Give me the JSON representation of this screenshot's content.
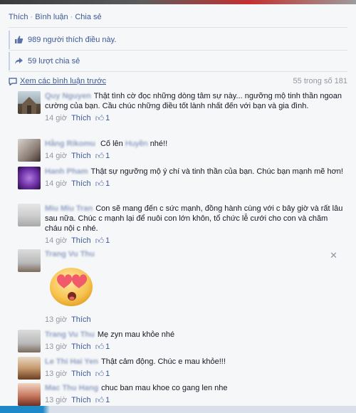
{
  "actions": {
    "like": "Thích",
    "comment": "Bình luận",
    "share": "Chia sẻ"
  },
  "likes": {
    "count": "989",
    "text": "người thích điều này."
  },
  "shares": {
    "text": "59 lượt chia sẻ"
  },
  "previous": {
    "label": "Xem các bình luận trước",
    "count": "55 trong số 181"
  },
  "comments": [
    {
      "author": "Quy Nguyen",
      "text": "Thật tình cờ đọc những dòng tâm sự này... ngưỡng mộ tinh thần ngoan cường của bạn. Cầu chúc những điều tốt lành nhất đến với bạn và gia đình.",
      "time": "14 giờ",
      "like": "Thích",
      "likes": "1"
    },
    {
      "author": "Hằng Rikomu",
      "text_pre": "Cố lên",
      "mention": "Huyền",
      "text_post": "nhé!!",
      "time": "14 giờ",
      "like": "Thích",
      "likes": "1"
    },
    {
      "author": "Hanh Pham",
      "text": "Thật sự ngưỡng mộ ý chí và tinh thần của bạn. Chúc bạn mạnh mẽ hơn!",
      "time": "14 giờ",
      "like": "Thích",
      "likes": "1"
    },
    {
      "author": "Miu Miu Tran",
      "text": "Con sẽ mang đến c sức mạnh, đồng hành cùng với c bây giờ và rất lâu sau nữa. Chúc c mạnh lại để nuôi con lớn khôn, tổ chức lễ cưới cho con và chăm cháu nội c nhé.",
      "time": "14 giờ",
      "like": "Thích",
      "likes": "1"
    },
    {
      "author": "Trang Vu Thu",
      "time": "13 giờ",
      "like": "Thích"
    },
    {
      "author": "Trang Vu Thu",
      "text": "Mẹ zyn mau khỏe nhé",
      "time": "13 giờ",
      "like": "Thích",
      "likes": "1"
    },
    {
      "author": "Le Thi Hai Yen",
      "text": "Thật cảm động. Chúc e mau khỏe!!!",
      "time": "13 giờ",
      "like": "Thích",
      "likes": "1"
    },
    {
      "author": "Mac Thu Hang",
      "text": "chuc ban mau khoe co gang len nhe",
      "time": "13 giờ",
      "like": "Thích",
      "likes": "1"
    }
  ],
  "icons": {
    "thumb": "thumbs-up-icon",
    "share": "share-arrow-icon",
    "comment": "comment-icon",
    "close": "close-icon"
  },
  "colors": {
    "link": "#3b5998",
    "meta": "#9197a3",
    "background": "#f6f7f8"
  }
}
